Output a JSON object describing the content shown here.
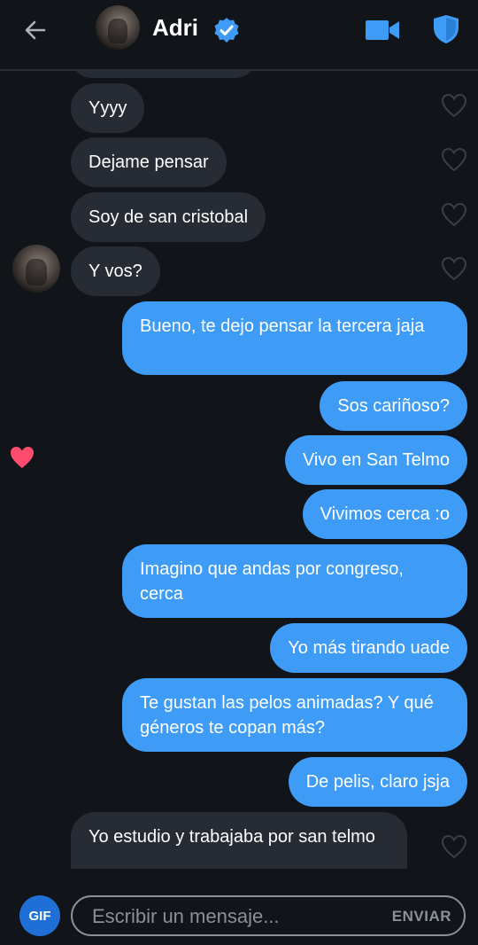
{
  "header": {
    "contact_name": "Adri",
    "verified": true
  },
  "messages": [
    {
      "side": "in",
      "text": "Yyyy",
      "liked": false
    },
    {
      "side": "in",
      "text": "Dejame pensar",
      "liked": false
    },
    {
      "side": "in",
      "text": "Soy de san cristobal",
      "liked": false
    },
    {
      "side": "in",
      "text": "Y vos?",
      "liked": false
    },
    {
      "side": "out",
      "text": "Bueno, te dejo pensar la tercera jaja"
    },
    {
      "side": "out",
      "text": "Sos cariñoso?"
    },
    {
      "side": "out",
      "text": "Vivo en San Telmo",
      "liked": true
    },
    {
      "side": "out",
      "text": "Vivimos cerca :o"
    },
    {
      "side": "out",
      "text": "Imagino que andas por congreso, cerca"
    },
    {
      "side": "out",
      "text": "Yo más tirando uade"
    },
    {
      "side": "out",
      "text": "Te gustan las pelos animadas? Y qué géneros te copan más?"
    },
    {
      "side": "out",
      "text": "De pelis, claro jsja"
    },
    {
      "side": "in",
      "text": "Yo estudio y trabajaba por san telmo",
      "liked": false
    }
  ],
  "composer": {
    "gif_label": "GIF",
    "placeholder": "Escribir un mensaje...",
    "send_label": "ENVIAR"
  },
  "colors": {
    "background": "#111418",
    "incoming_bubble": "#272b33",
    "outgoing_bubble": "#3e9cf7",
    "accent": "#3e9cf7",
    "liked_heart": "#ff4d6d"
  },
  "icons": [
    "back-arrow-icon",
    "verified-badge-icon",
    "video-call-icon",
    "shield-icon",
    "heart-outline-icon",
    "heart-filled-icon"
  ]
}
